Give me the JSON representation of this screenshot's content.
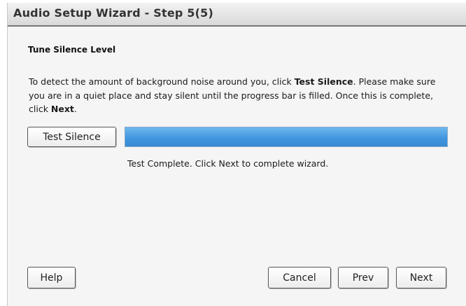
{
  "window": {
    "title": "Audio Setup Wizard - Step 5(5)"
  },
  "section": {
    "title": "Tune Silence Level"
  },
  "description": {
    "part1": "To detect the amount of background noise around you, click ",
    "bold1": "Test Silence",
    "part2": ". Please make sure you are in a quiet place and stay silent until the progress bar is filled. Once this is complete, click ",
    "bold2": "Next",
    "part3": "."
  },
  "test_button": {
    "label": "Test Silence"
  },
  "progress": {
    "percent": 100,
    "fill_color": "#3f94de"
  },
  "status_text": "Test Complete. Click Next to complete wizard.",
  "footer": {
    "help_label": "Help",
    "cancel_label": "Cancel",
    "prev_label": "Prev",
    "next_label": "Next"
  }
}
